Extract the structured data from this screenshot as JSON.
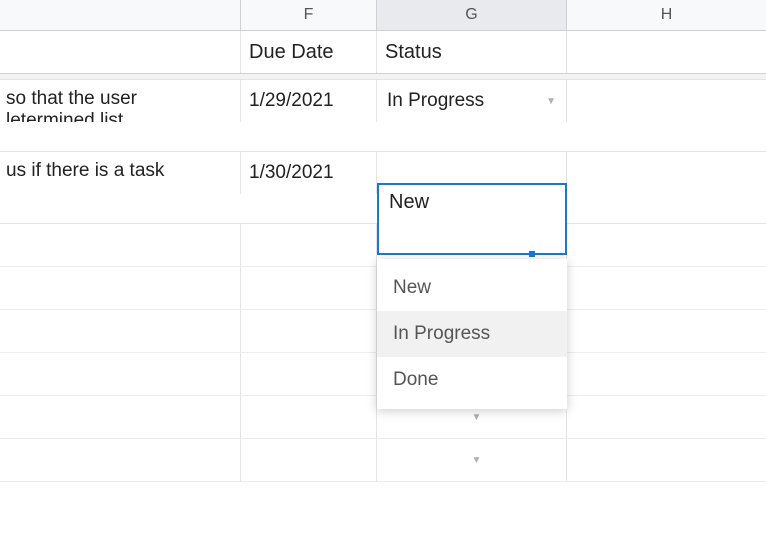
{
  "columns": {
    "F": "F",
    "G": "G",
    "H": "H"
  },
  "header_row": {
    "F": "Due Date",
    "G": "Status",
    "H": ""
  },
  "rows": [
    {
      "E_fragment": "so that the user letermined list",
      "E_line1": "so that the user",
      "E_line2": "letermined list",
      "F": "1/29/2021",
      "G": "In Progress"
    },
    {
      "E_fragment": "us if there is a task",
      "F": "1/30/2021",
      "G": "New"
    }
  ],
  "editing_value": "New",
  "dropdown": {
    "options": [
      "New",
      "In Progress",
      "Done"
    ],
    "hover_index": 1
  },
  "colors": {
    "selection": "#1a73e8",
    "border": "#e3e3e3",
    "header_bg": "#f8f9fa"
  }
}
